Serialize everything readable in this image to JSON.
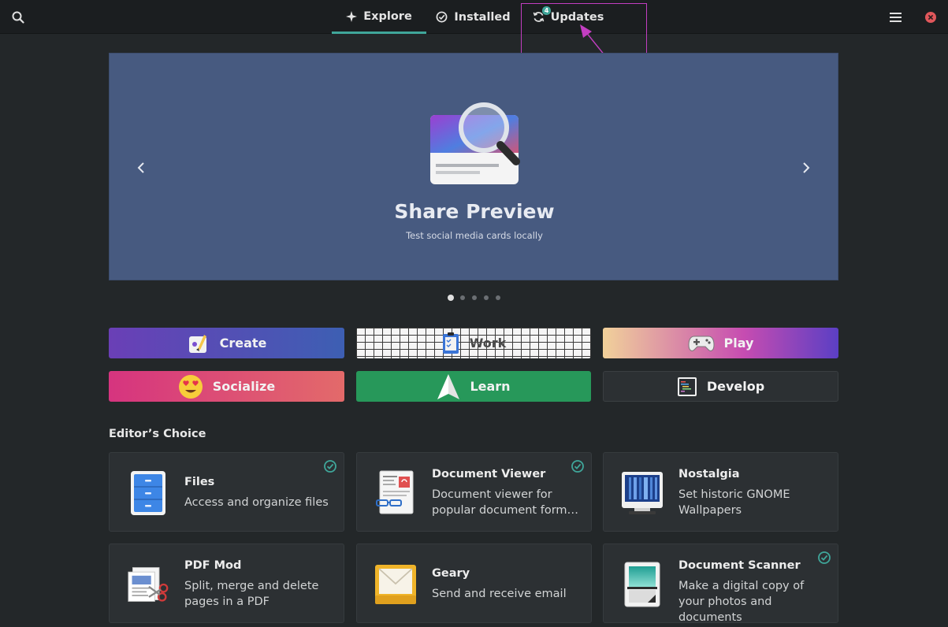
{
  "header": {
    "tabs": [
      {
        "label": "Explore",
        "active": true,
        "icon": "explore-icon"
      },
      {
        "label": "Installed",
        "active": false,
        "icon": "check-circle-icon"
      },
      {
        "label": "Updates",
        "active": false,
        "icon": "refresh-icon",
        "badge": "4"
      }
    ]
  },
  "banner": {
    "title": "Share Preview",
    "subtitle": "Test social media cards locally",
    "slide_count": 5,
    "active_slide": 0
  },
  "categories": [
    {
      "label": "Create",
      "icon": "palette-icon"
    },
    {
      "label": "Work",
      "icon": "clipboard-icon"
    },
    {
      "label": "Play",
      "icon": "gamepad-icon"
    },
    {
      "label": "Socialize",
      "icon": "heart-eyes-emoji-icon"
    },
    {
      "label": "Learn",
      "icon": "paper-plane-icon"
    },
    {
      "label": "Develop",
      "icon": "code-terminal-icon"
    }
  ],
  "editors_choice": {
    "title": "Editor’s Choice",
    "apps": [
      {
        "name": "Files",
        "description": "Access and organize files",
        "installed": true,
        "icon": "files-icon"
      },
      {
        "name": "Document Viewer",
        "description": "Document viewer for popular document form…",
        "installed": true,
        "icon": "document-viewer-icon"
      },
      {
        "name": "Nostalgia",
        "description": "Set historic GNOME Wallpapers",
        "installed": false,
        "icon": "nostalgia-icon"
      },
      {
        "name": "PDF Mod",
        "description": "Split, merge and delete pages in a PDF",
        "installed": false,
        "icon": "pdf-mod-icon"
      },
      {
        "name": "Geary",
        "description": "Send and receive email",
        "installed": false,
        "icon": "geary-icon"
      },
      {
        "name": "Document Scanner",
        "description": "Make a digital copy of your photos and documents",
        "installed": true,
        "icon": "document-scanner-icon"
      }
    ]
  },
  "colors": {
    "accent": "#3fa69a",
    "annotation": "#c23ec1",
    "banner": "#475a80"
  }
}
